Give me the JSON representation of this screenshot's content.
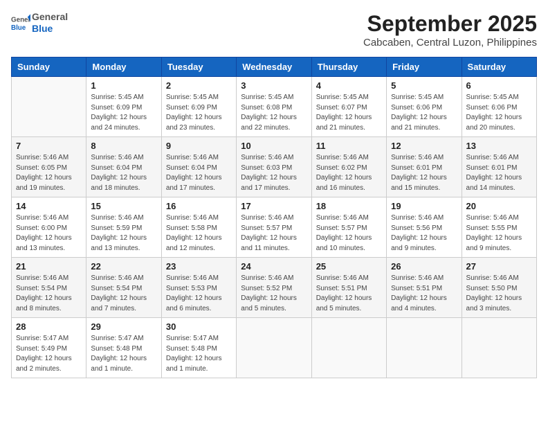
{
  "header": {
    "logo_line1": "General",
    "logo_line2": "Blue",
    "title": "September 2025",
    "subtitle": "Cabcaben, Central Luzon, Philippines"
  },
  "weekdays": [
    "Sunday",
    "Monday",
    "Tuesday",
    "Wednesday",
    "Thursday",
    "Friday",
    "Saturday"
  ],
  "weeks": [
    [
      {
        "day": "",
        "sunrise": "",
        "sunset": "",
        "daylight": ""
      },
      {
        "day": "1",
        "sunrise": "Sunrise: 5:45 AM",
        "sunset": "Sunset: 6:09 PM",
        "daylight": "Daylight: 12 hours and 24 minutes."
      },
      {
        "day": "2",
        "sunrise": "Sunrise: 5:45 AM",
        "sunset": "Sunset: 6:09 PM",
        "daylight": "Daylight: 12 hours and 23 minutes."
      },
      {
        "day": "3",
        "sunrise": "Sunrise: 5:45 AM",
        "sunset": "Sunset: 6:08 PM",
        "daylight": "Daylight: 12 hours and 22 minutes."
      },
      {
        "day": "4",
        "sunrise": "Sunrise: 5:45 AM",
        "sunset": "Sunset: 6:07 PM",
        "daylight": "Daylight: 12 hours and 21 minutes."
      },
      {
        "day": "5",
        "sunrise": "Sunrise: 5:45 AM",
        "sunset": "Sunset: 6:06 PM",
        "daylight": "Daylight: 12 hours and 21 minutes."
      },
      {
        "day": "6",
        "sunrise": "Sunrise: 5:45 AM",
        "sunset": "Sunset: 6:06 PM",
        "daylight": "Daylight: 12 hours and 20 minutes."
      }
    ],
    [
      {
        "day": "7",
        "sunrise": "Sunrise: 5:46 AM",
        "sunset": "Sunset: 6:05 PM",
        "daylight": "Daylight: 12 hours and 19 minutes."
      },
      {
        "day": "8",
        "sunrise": "Sunrise: 5:46 AM",
        "sunset": "Sunset: 6:04 PM",
        "daylight": "Daylight: 12 hours and 18 minutes."
      },
      {
        "day": "9",
        "sunrise": "Sunrise: 5:46 AM",
        "sunset": "Sunset: 6:04 PM",
        "daylight": "Daylight: 12 hours and 17 minutes."
      },
      {
        "day": "10",
        "sunrise": "Sunrise: 5:46 AM",
        "sunset": "Sunset: 6:03 PM",
        "daylight": "Daylight: 12 hours and 17 minutes."
      },
      {
        "day": "11",
        "sunrise": "Sunrise: 5:46 AM",
        "sunset": "Sunset: 6:02 PM",
        "daylight": "Daylight: 12 hours and 16 minutes."
      },
      {
        "day": "12",
        "sunrise": "Sunrise: 5:46 AM",
        "sunset": "Sunset: 6:01 PM",
        "daylight": "Daylight: 12 hours and 15 minutes."
      },
      {
        "day": "13",
        "sunrise": "Sunrise: 5:46 AM",
        "sunset": "Sunset: 6:01 PM",
        "daylight": "Daylight: 12 hours and 14 minutes."
      }
    ],
    [
      {
        "day": "14",
        "sunrise": "Sunrise: 5:46 AM",
        "sunset": "Sunset: 6:00 PM",
        "daylight": "Daylight: 12 hours and 13 minutes."
      },
      {
        "day": "15",
        "sunrise": "Sunrise: 5:46 AM",
        "sunset": "Sunset: 5:59 PM",
        "daylight": "Daylight: 12 hours and 13 minutes."
      },
      {
        "day": "16",
        "sunrise": "Sunrise: 5:46 AM",
        "sunset": "Sunset: 5:58 PM",
        "daylight": "Daylight: 12 hours and 12 minutes."
      },
      {
        "day": "17",
        "sunrise": "Sunrise: 5:46 AM",
        "sunset": "Sunset: 5:57 PM",
        "daylight": "Daylight: 12 hours and 11 minutes."
      },
      {
        "day": "18",
        "sunrise": "Sunrise: 5:46 AM",
        "sunset": "Sunset: 5:57 PM",
        "daylight": "Daylight: 12 hours and 10 minutes."
      },
      {
        "day": "19",
        "sunrise": "Sunrise: 5:46 AM",
        "sunset": "Sunset: 5:56 PM",
        "daylight": "Daylight: 12 hours and 9 minutes."
      },
      {
        "day": "20",
        "sunrise": "Sunrise: 5:46 AM",
        "sunset": "Sunset: 5:55 PM",
        "daylight": "Daylight: 12 hours and 9 minutes."
      }
    ],
    [
      {
        "day": "21",
        "sunrise": "Sunrise: 5:46 AM",
        "sunset": "Sunset: 5:54 PM",
        "daylight": "Daylight: 12 hours and 8 minutes."
      },
      {
        "day": "22",
        "sunrise": "Sunrise: 5:46 AM",
        "sunset": "Sunset: 5:54 PM",
        "daylight": "Daylight: 12 hours and 7 minutes."
      },
      {
        "day": "23",
        "sunrise": "Sunrise: 5:46 AM",
        "sunset": "Sunset: 5:53 PM",
        "daylight": "Daylight: 12 hours and 6 minutes."
      },
      {
        "day": "24",
        "sunrise": "Sunrise: 5:46 AM",
        "sunset": "Sunset: 5:52 PM",
        "daylight": "Daylight: 12 hours and 5 minutes."
      },
      {
        "day": "25",
        "sunrise": "Sunrise: 5:46 AM",
        "sunset": "Sunset: 5:51 PM",
        "daylight": "Daylight: 12 hours and 5 minutes."
      },
      {
        "day": "26",
        "sunrise": "Sunrise: 5:46 AM",
        "sunset": "Sunset: 5:51 PM",
        "daylight": "Daylight: 12 hours and 4 minutes."
      },
      {
        "day": "27",
        "sunrise": "Sunrise: 5:46 AM",
        "sunset": "Sunset: 5:50 PM",
        "daylight": "Daylight: 12 hours and 3 minutes."
      }
    ],
    [
      {
        "day": "28",
        "sunrise": "Sunrise: 5:47 AM",
        "sunset": "Sunset: 5:49 PM",
        "daylight": "Daylight: 12 hours and 2 minutes."
      },
      {
        "day": "29",
        "sunrise": "Sunrise: 5:47 AM",
        "sunset": "Sunset: 5:48 PM",
        "daylight": "Daylight: 12 hours and 1 minute."
      },
      {
        "day": "30",
        "sunrise": "Sunrise: 5:47 AM",
        "sunset": "Sunset: 5:48 PM",
        "daylight": "Daylight: 12 hours and 1 minute."
      },
      {
        "day": "",
        "sunrise": "",
        "sunset": "",
        "daylight": ""
      },
      {
        "day": "",
        "sunrise": "",
        "sunset": "",
        "daylight": ""
      },
      {
        "day": "",
        "sunrise": "",
        "sunset": "",
        "daylight": ""
      },
      {
        "day": "",
        "sunrise": "",
        "sunset": "",
        "daylight": ""
      }
    ]
  ]
}
